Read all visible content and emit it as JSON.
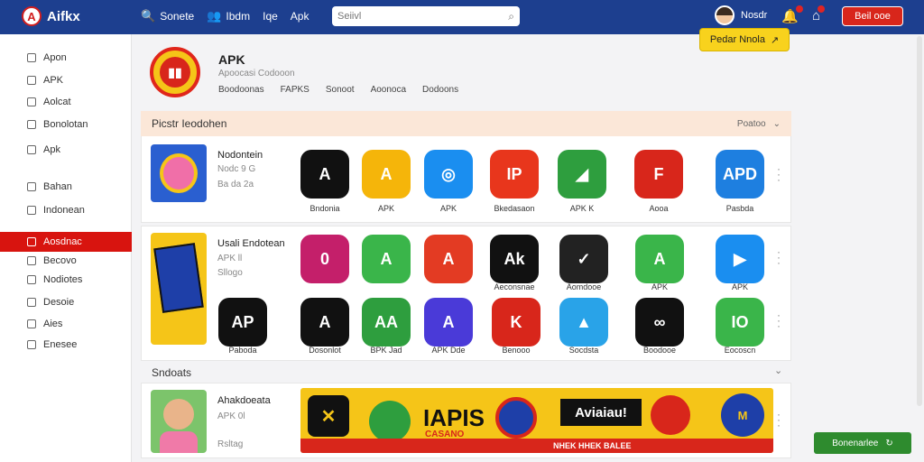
{
  "topbar": {
    "logo_text": "Aifkx",
    "logo_mark": "A",
    "nav": [
      {
        "icon": "search-icon",
        "glyph": "🔍",
        "label": "Sonete"
      },
      {
        "icon": "user-icon",
        "glyph": "👥",
        "label": "Ibdm"
      },
      {
        "icon": "",
        "glyph": "",
        "label": "Iqe"
      },
      {
        "icon": "",
        "glyph": "",
        "label": "Apk"
      }
    ],
    "search_placeholder": "Seiivl",
    "user_name": "Nosdr",
    "get_button": "Beil ooe",
    "colors": {
      "bar": "#1d3f8f",
      "accent": "#d8261b"
    }
  },
  "sidebar": {
    "items": [
      {
        "label": "Apon",
        "active": false
      },
      {
        "label": "APK",
        "active": false
      },
      {
        "label": "Aolcat",
        "active": false
      },
      {
        "label": "Bonolotan",
        "active": false
      },
      {
        "label": "Apk",
        "active": false
      },
      {
        "label": "Bahan",
        "active": false
      },
      {
        "label": "Indonean",
        "active": false
      },
      {
        "label": "Aosdnac",
        "active": true
      },
      {
        "label": "Becovo",
        "active": false
      },
      {
        "label": "Nodiotes",
        "active": false
      },
      {
        "label": "Desoie",
        "active": false
      },
      {
        "label": "Aies",
        "active": false
      },
      {
        "label": "Enesee",
        "active": false
      }
    ]
  },
  "header": {
    "app_name": "APK",
    "subtitle": "Apoocasi Codooon",
    "tabs": [
      "Boodoonas",
      "FAPKS",
      "Sonoot",
      "Aoonoca",
      "Dodoons"
    ],
    "cta_label": "Pedar Nnola",
    "cta_icon": "↗"
  },
  "section1": {
    "title": "Picstr Ieodohen",
    "right_label": "Poatoo",
    "feature": {
      "title": "Nodontein",
      "sub1": "Nodc 9 G",
      "sub2": "Ba da 2a"
    },
    "apps": [
      {
        "label": "Bndonia",
        "text": "A",
        "color": "#111111"
      },
      {
        "label": "APK",
        "text": "A",
        "color": "#f5b50a"
      },
      {
        "label": "APK",
        "text": "◎",
        "color": "#1a8ef0"
      },
      {
        "label": "Bkedasaon",
        "text": "IP",
        "color": "#e8361c"
      },
      {
        "label": "APK K",
        "text": "◢",
        "color": "#2e9e3e"
      },
      {
        "label": "Aooa",
        "text": "F",
        "color": "#d8261b"
      },
      {
        "label": "Pasbda",
        "text": "APD",
        "color": "#1e7fe0"
      }
    ]
  },
  "section2": {
    "feature": {
      "title": "Usali Endotean",
      "sub1": "APK ll",
      "sub2": "Sllogo"
    },
    "apps_row1": [
      {
        "label": "",
        "text": "0",
        "color": "#c41f6a"
      },
      {
        "label": "",
        "text": "A",
        "color": "#3ab54a"
      },
      {
        "label": "",
        "text": "A",
        "color": "#e33b23"
      },
      {
        "label": "Aeconsnae",
        "text": "Ak",
        "color": "#111111"
      },
      {
        "label": "Aomdooe",
        "text": "✓",
        "color": "#222222"
      },
      {
        "label": "APK",
        "text": "A",
        "color": "#3ab54a"
      },
      {
        "label": "APK",
        "text": "▶",
        "color": "#1a8ef0"
      }
    ],
    "apps_row2": [
      {
        "label": "Paboda",
        "text": "AP",
        "color": "#111111"
      },
      {
        "label": "Dosonlot",
        "text": "A",
        "color": "#111111"
      },
      {
        "label": "BPK Jad",
        "text": "AA",
        "color": "#2e9e3e"
      },
      {
        "label": "APK Dde",
        "text": "A",
        "color": "#4a3ad8"
      },
      {
        "label": "Benooo",
        "text": "K",
        "color": "#d8261b"
      },
      {
        "label": "Socdsta",
        "text": "▲",
        "color": "#29a3e8"
      },
      {
        "label": "Boodooe",
        "text": "∞",
        "color": "#111111"
      },
      {
        "label": "Eocoscn",
        "text": "IO",
        "color": "#3ab54a"
      }
    ]
  },
  "section3": {
    "title": "Sndoats",
    "feature": {
      "title": "Ahakdoeata",
      "sub1": "APK 0l",
      "sub2": "Rsltag"
    },
    "banner_text": "IAPIS",
    "banner_sub": "CASANO",
    "banner_right": "Aviaiau!",
    "banner_strip": "NHEK HHEK BALEE"
  },
  "footer_button": "Bonenarlee"
}
